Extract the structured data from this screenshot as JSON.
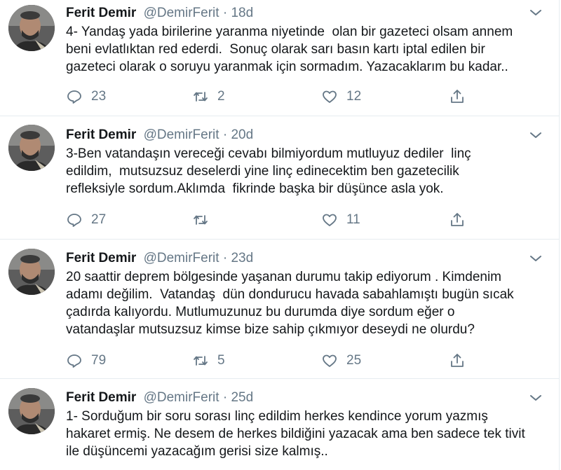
{
  "tweets": [
    {
      "name": "Ferit Demir",
      "handle": "@DemirFerit",
      "separator": "·",
      "time": "18d",
      "text": "4- Yandaş yada birilerine yaranma niyetinde  olan bir gazeteci olsam annem\nbeni evlatlıktan red ederdi.  Sonuç olarak sarı basın kartı iptal edilen bir\ngazeteci olarak o soruyu yaranmak için sormadım. Yazacaklarım bu kadar..",
      "replies": "23",
      "retweets": "2",
      "likes": "12"
    },
    {
      "name": "Ferit Demir",
      "handle": "@DemirFerit",
      "separator": "·",
      "time": "20d",
      "text": "3-Ben vatandaşın vereceği cevabı bilmiyordum mutluyuz dediler  linç\nedildim,  mutsuzsuz deselerdi yine linç edinecektim ben gazetecilik\nrefleksiyle sordum.Aklımda  fikrinde başka bir düşünce asla yok.",
      "replies": "27",
      "retweets": "",
      "likes": "11"
    },
    {
      "name": "Ferit Demir",
      "handle": "@DemirFerit",
      "separator": "·",
      "time": "23d",
      "text": "20 saattir deprem bölgesinde yaşanan durumu takip ediyorum . Kimdenim\nadamı değilim.  Vatandaş  dün dondurucu havada sabahlamıştı bugün sıcak\nçadırda kalıyordu. Mutlumuzunuz bu durumda diye sordum eğer o\nvatandaşlar mutsuzsuz kimse bize sahip çıkmıyor deseydi ne olurdu?",
      "replies": "79",
      "retweets": "5",
      "likes": "25"
    },
    {
      "name": "Ferit Demir",
      "handle": "@DemirFerit",
      "separator": "·",
      "time": "25d",
      "text": "1- Sorduğum bir soru sorası linç edildim herkes kendince yorum yazmış\nhakaret ermiş. Ne desem de herkes bildiğini yazacak ama ben sadece tek tivit\nile düşüncemi yazacağım gerisi size kalmış..",
      "replies": "",
      "retweets": "",
      "likes": ""
    }
  ],
  "icons": {
    "reply": "reply-icon",
    "retweet": "retweet-icon",
    "like": "like-icon",
    "share": "share-icon",
    "caret": "chevron-down-icon"
  },
  "colors": {
    "text": "#14171a",
    "muted": "#657786",
    "divider": "#e6ecf0"
  }
}
